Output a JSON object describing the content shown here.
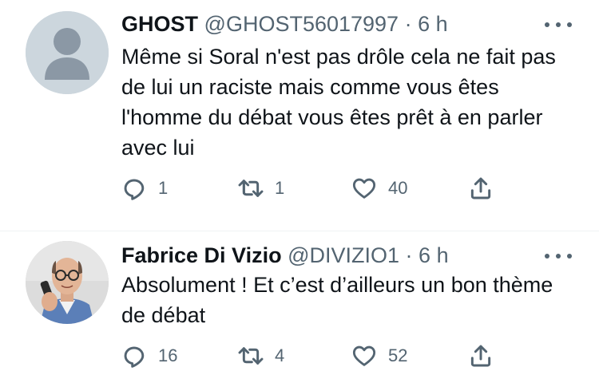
{
  "tweets": [
    {
      "name": "GHOST",
      "handle": "@GHOST56017997",
      "separator": "·",
      "time": "6 h",
      "text": "Même si Soral n'est pas drôle cela ne fait pas de lui un raciste mais comme vous êtes l'homme du débat vous êtes prêt à en parler avec lui",
      "replies": "1",
      "retweets": "1",
      "likes": "40",
      "avatar": "default-avatar"
    },
    {
      "name": "Fabrice Di Vizio",
      "handle": "@DIVIZIO1",
      "separator": "·",
      "time": "6 h",
      "text": "Absolument ! Et c’est d’ailleurs un bon thème de débat",
      "replies": "16",
      "retweets": "4",
      "likes": "52",
      "avatar": "profile-photo"
    }
  ],
  "colors": {
    "text": "#0f1419",
    "secondary": "#536471",
    "default_avatar_bg": "#ccd6dd",
    "default_avatar_fg": "#8b98a5"
  },
  "icons": [
    "reply-icon",
    "retweet-icon",
    "like-icon",
    "share-icon",
    "more-icon"
  ]
}
